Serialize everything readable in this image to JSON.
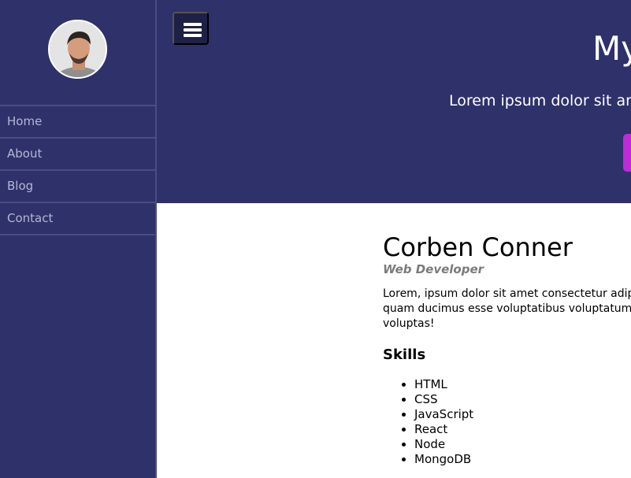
{
  "sidebar": {
    "avatar_alt": "Profile photo",
    "nav_items": [
      {
        "label": "Home"
      },
      {
        "label": "About"
      },
      {
        "label": "Blog"
      },
      {
        "label": "Contact"
      }
    ]
  },
  "header": {
    "menu_icon": "hamburger-menu-icon",
    "title": "My",
    "subtitle": "Lorem ipsum dolor sit ame",
    "cta_color": "#c02ad8"
  },
  "profile": {
    "name": "Corben Conner",
    "role": "Web Developer",
    "bio": "Lorem, ipsum dolor sit amet consectetur adipi quam ducimus esse voluptatibus voluptatum, voluptas!",
    "skills_heading": "Skills",
    "skills": [
      "HTML",
      "CSS",
      "JavaScript",
      "React",
      "Node",
      "MongoDB"
    ]
  },
  "colors": {
    "sidebar_bg": "#2f316b",
    "header_bg": "#2f316b",
    "accent": "#c02ad8",
    "menu_button_bg": "#1f2046"
  }
}
